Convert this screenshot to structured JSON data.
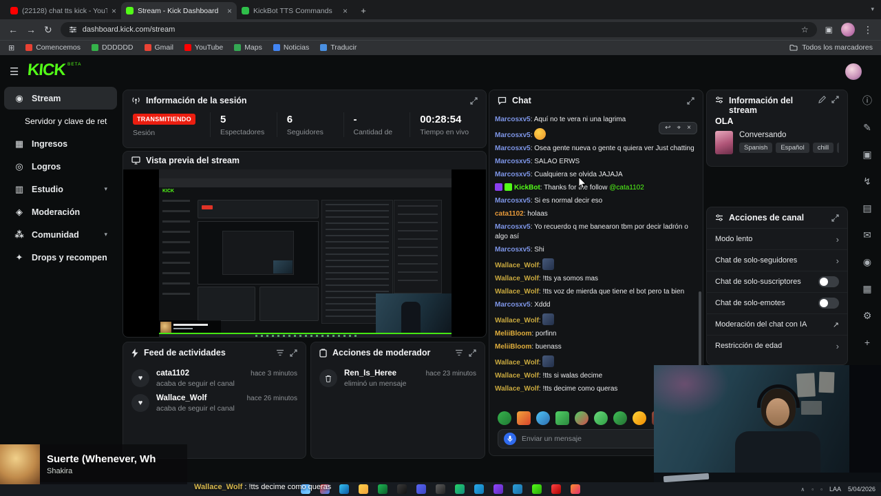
{
  "browser": {
    "tabs": [
      {
        "title": "(22128) chat tts kick - YouTube",
        "favicon": "youtube-favicon",
        "fav_color": "#ff0000"
      },
      {
        "title": "Stream - Kick Dashboard",
        "favicon": "kick-favicon",
        "fav_color": "#53fc18"
      },
      {
        "title": "KickBot TTS Commands",
        "favicon": "kickbot-favicon",
        "fav_color": "#2fbf4a"
      }
    ],
    "active_tab": 1,
    "new_tab_label": "+",
    "url": "dashboard.kick.com/stream",
    "bookmarks": [
      {
        "label": "Comencemos",
        "color": "#e84133"
      },
      {
        "label": "DDDDDD",
        "color": "#35b24a"
      },
      {
        "label": "Gmail",
        "color": "#ea4335"
      },
      {
        "label": "YouTube",
        "color": "#ff0000"
      },
      {
        "label": "Maps",
        "color": "#34a853"
      },
      {
        "label": "Noticias",
        "color": "#4285f4"
      },
      {
        "label": "Traducir",
        "color": "#4a90e2"
      }
    ],
    "all_bookmarks_label": "Todos los marcadores"
  },
  "dashboard": {
    "logo": "KICK",
    "beta": "BETA"
  },
  "sidebar": [
    {
      "label": "Stream",
      "icon": "stream-icon",
      "glyph": "◉",
      "active": true
    },
    {
      "label": "Servidor y clave de retransm",
      "sub": true
    },
    {
      "label": "Ingresos",
      "icon": "income-icon",
      "glyph": "▦"
    },
    {
      "label": "Logros",
      "icon": "achievements-icon",
      "glyph": "◎"
    },
    {
      "label": "Estudio",
      "icon": "studio-icon",
      "glyph": "▥",
      "chevron": true
    },
    {
      "label": "Moderación",
      "icon": "moderation-icon",
      "glyph": "◈"
    },
    {
      "label": "Comunidad",
      "icon": "community-icon",
      "glyph": "⁂",
      "chevron": true
    },
    {
      "label": "Drops y recompensas",
      "icon": "drops-icon",
      "glyph": "✦"
    }
  ],
  "session": {
    "title": "Información de la sesión",
    "live_badge": "TRANSMITIENDO",
    "live_label": "Sesión",
    "stats": [
      {
        "value": "5",
        "label": "Espectadores"
      },
      {
        "value": "6",
        "label": "Seguidores"
      },
      {
        "value": "-",
        "label": "Cantidad de"
      },
      {
        "value": "00:28:54",
        "label": "Tiempo en vivo"
      }
    ]
  },
  "preview": {
    "title": "Vista previa del stream",
    "mini_logo": "KICK"
  },
  "activity_feed": {
    "title": "Feed de actividades",
    "items": [
      {
        "user": "cata1102",
        "action": "acaba de seguir el canal",
        "time": "hace 3 minutos"
      },
      {
        "user": "Wallace_Wolf",
        "action": "acaba de seguir el canal",
        "time": "hace 26 minutos"
      }
    ]
  },
  "mod_actions": {
    "title": "Acciones de moderador",
    "items": [
      {
        "user": "Ren_Is_Heree",
        "action": "eliminó un mensaje",
        "time": "hace 23 minutos"
      }
    ]
  },
  "chat": {
    "title": "Chat",
    "placeholder": "Enviar un mensaje",
    "user_colors": {
      "Marcosxv5": "#7e96e8",
      "cata1102": "#e79a3a",
      "KickBot": "#53fc18",
      "Wallace_Wolf": "#c9a93f",
      "MeliiBloom": "#e0ae3c"
    },
    "messages": [
      {
        "user": "Marcosxv5",
        "text": "Aquí no te vera ni una lagrima"
      },
      {
        "user": "Marcosxv5",
        "emote": "emote-smile",
        "toolbar": true
      },
      {
        "user": "Marcosxv5",
        "text": "Osea gente nueva o gente q quiera ver Just chatting"
      },
      {
        "user": "Marcosxv5",
        "text": "SALAO ERWS"
      },
      {
        "user": "Marcosxv5",
        "text": "Cualquiera se olvida JAJAJA"
      },
      {
        "user": "KickBot",
        "badges": [
          "moderator-badge",
          "bot-badge"
        ],
        "text": "Thanks for the follow @cata1102",
        "mention": "@cata1102"
      },
      {
        "user": "Marcosxv5",
        "text": "Si es normal decir eso"
      },
      {
        "user": "cata1102",
        "text": "holaas"
      },
      {
        "user": "Marcosxv5",
        "text": "Yo recuerdo q me banearon tbm por decir ladrón o algo así"
      },
      {
        "user": "Marcosxv5",
        "text": "Shi"
      },
      {
        "user": "Wallace_Wolf",
        "emote": "emote-image"
      },
      {
        "user": "Wallace_Wolf",
        "text": "!tts ya somos mas"
      },
      {
        "user": "Wallace_Wolf",
        "text": "!tts voz de mierda que tiene el bot pero ta bien"
      },
      {
        "user": "Marcosxv5",
        "text": "Xddd"
      },
      {
        "user": "Wallace_Wolf",
        "emote": "emote-image"
      },
      {
        "user": "MeliiBloom",
        "text": "porfinn"
      },
      {
        "user": "MeliiBloom",
        "text": "buenass"
      },
      {
        "user": "Wallace_Wolf",
        "emote": "emote-image"
      },
      {
        "user": "Wallace_Wolf",
        "text": "!tts si walas decime"
      },
      {
        "user": "Wallace_Wolf",
        "text": "!tts decime como queras"
      }
    ]
  },
  "stream_info": {
    "title": "Información del stream",
    "stream_title": "OLA",
    "category": "Conversando",
    "tags": [
      "Spanish",
      "Español",
      "chill",
      "fu"
    ]
  },
  "channel_actions": {
    "title": "Acciones de canal",
    "items": [
      {
        "label": "Modo lento",
        "control": "chevron"
      },
      {
        "label": "Chat de solo-seguidores",
        "control": "chevron"
      },
      {
        "label": "Chat de solo-suscriptores",
        "control": "toggle",
        "on": false
      },
      {
        "label": "Chat de solo-emotes",
        "control": "toggle",
        "on": false
      },
      {
        "label": "Moderación del chat con IA",
        "control": "external"
      },
      {
        "label": "Restricción de edad",
        "control": "chevron"
      }
    ]
  },
  "right_rail": [
    {
      "name": "info-icon",
      "glyph": "ⓘ"
    },
    {
      "name": "edit-stream-icon",
      "glyph": "✎"
    },
    {
      "name": "camera-icon",
      "glyph": "▣"
    },
    {
      "name": "boost-icon",
      "glyph": "↯"
    },
    {
      "name": "wallet-icon",
      "glyph": "▤"
    },
    {
      "name": "chat-settings-icon",
      "glyph": "✉"
    },
    {
      "name": "broadcast-icon",
      "glyph": "◉"
    },
    {
      "name": "layout-icon",
      "glyph": "▦"
    },
    {
      "name": "settings-icon",
      "glyph": "⚙"
    },
    {
      "name": "invite-icon",
      "glyph": "+"
    }
  ],
  "quick_emotes": [
    {
      "name": "emote-green-face",
      "c1": "#37b24d",
      "c2": "#1f7a33",
      "round": true
    },
    {
      "name": "emote-fire",
      "c1": "#f2a33c",
      "c2": "#d8452b"
    },
    {
      "name": "emote-globe",
      "c1": "#4fc3f7",
      "c2": "#2d6fb0",
      "round": true
    },
    {
      "name": "emote-green-1",
      "c1": "#51cf66",
      "c2": "#2b8a3e"
    },
    {
      "name": "emote-multi",
      "c1": "#51cf66",
      "c2": "#d14b4b",
      "round": true
    },
    {
      "name": "emote-green-2",
      "c1": "#69db7c",
      "c2": "#2f9e44",
      "round": true
    },
    {
      "name": "emote-green-3",
      "c1": "#40c057",
      "c2": "#237032",
      "round": true
    },
    {
      "name": "emote-yellow",
      "c1": "#ffd43b",
      "c2": "#f08c00",
      "round": true
    },
    {
      "name": "emote-dark",
      "c1": "#9a4a3a",
      "c2": "#4a1f1a"
    }
  ],
  "music_overlay": {
    "track": "Suerte (Whenever, Wh",
    "artist": "Shakira"
  },
  "overlay_chat": {
    "user": "Wallace_Wolf",
    "separator": " : ",
    "text": "!tts decime como queras"
  },
  "taskbar": {
    "lang": "LAA",
    "date": "5/04/2026",
    "apps": [
      {
        "name": "taskbar-widgets-icon",
        "c1": "#4aa3ff",
        "c2": "#7fd0ff"
      },
      {
        "name": "taskbar-chrome-icon",
        "c1": "#ea4335",
        "c2": "#4285f4"
      },
      {
        "name": "taskbar-edge-icon",
        "c1": "#35c1f1",
        "c2": "#0c59a4"
      },
      {
        "name": "taskbar-explorer-icon",
        "c1": "#ffd04a",
        "c2": "#f2a33c"
      },
      {
        "name": "taskbar-spotify-icon",
        "c1": "#1db954",
        "c2": "#0e5c2a"
      },
      {
        "name": "taskbar-tiktok-icon",
        "c1": "#3a3a3a",
        "c2": "#111111"
      },
      {
        "name": "taskbar-discord-icon",
        "c1": "#5865f2",
        "c2": "#3b46c4"
      },
      {
        "name": "taskbar-obs-icon",
        "c1": "#5c5c5c",
        "c2": "#232323"
      },
      {
        "name": "taskbar-whatsapp-icon",
        "c1": "#25d366",
        "c2": "#128c7e"
      },
      {
        "name": "taskbar-telegram-icon",
        "c1": "#29a9eb",
        "c2": "#0f7bb5"
      },
      {
        "name": "taskbar-twitch-icon",
        "c1": "#9146ff",
        "c2": "#5c2bb8"
      },
      {
        "name": "taskbar-vscode-icon",
        "c1": "#2c9fd8",
        "c2": "#1b6fa8"
      },
      {
        "name": "taskbar-kick-icon",
        "c1": "#53fc18",
        "c2": "#2aa80a"
      },
      {
        "name": "taskbar-youtube-icon",
        "c1": "#ff4444",
        "c2": "#aa0000"
      },
      {
        "name": "taskbar-instagram-icon",
        "c1": "#fd8d32",
        "c2": "#e1306c"
      }
    ]
  }
}
